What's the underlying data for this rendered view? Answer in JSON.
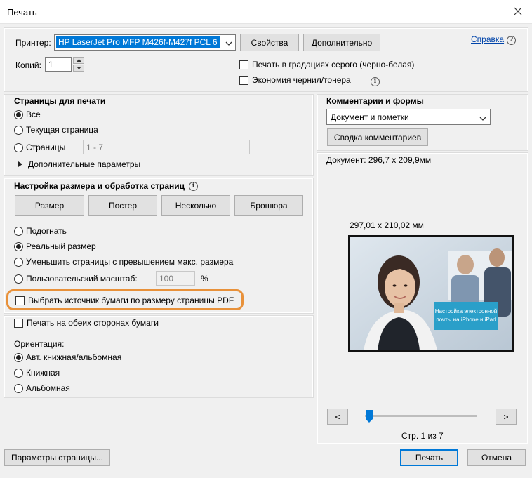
{
  "window": {
    "title": "Печать"
  },
  "printer": {
    "label": "Принтер:",
    "selected": "HP LaserJet Pro MFP M426f-M427f PCL 6",
    "properties_button": "Свойства",
    "advanced_button": "Дополнительно",
    "help_link": "Справка",
    "copies_label": "Копий:",
    "copies_value": "1",
    "grayscale_label": "Печать в градациях серого (черно-белая)",
    "save_ink_label": "Экономия чернил/тонера"
  },
  "pages": {
    "title": "Страницы для печати",
    "all": "Все",
    "current": "Текущая страница",
    "pages_label": "Страницы",
    "pages_value": "1 - 7",
    "more_options": "Дополнительные параметры"
  },
  "sizing": {
    "title": "Настройка размера и обработка страниц",
    "tabs": [
      "Размер",
      "Постер",
      "Несколько",
      "Брошюра"
    ],
    "fit": "Подогнать",
    "actual": "Реальный размер",
    "shrink": "Уменьшить страницы с превышением макс. размера",
    "custom_scale": "Пользовательский масштаб:",
    "custom_scale_value": "100",
    "percent": "%",
    "paper_source": "Выбрать источник бумаги по размеру страницы PDF"
  },
  "duplex": {
    "label": "Печать на обеих сторонах бумаги",
    "orientation_label": "Ориентация:",
    "auto": "Авт. книжная/альбомная",
    "portrait": "Книжная",
    "landscape": "Альбомная"
  },
  "comments": {
    "title": "Комментарии и формы",
    "selected": "Документ и пометки",
    "summarize_button": "Сводка комментариев"
  },
  "preview": {
    "document_size": "Документ: 296,7 x 209,9мм",
    "page_size": "297,01 x 210,02 мм",
    "overlay_text_line1": "Настройка электронной",
    "overlay_text_line2": "почты на iPhone и iPad",
    "prev": "<",
    "next": ">",
    "page_indicator": "Стр. 1 из 7",
    "slider_fraction": 0.0
  },
  "footer": {
    "page_setup": "Параметры страницы...",
    "print": "Печать",
    "cancel": "Отмена"
  },
  "colors": {
    "highlight": "#e8913a",
    "selection": "#0078d7",
    "overlay": "#2a9fc9"
  }
}
